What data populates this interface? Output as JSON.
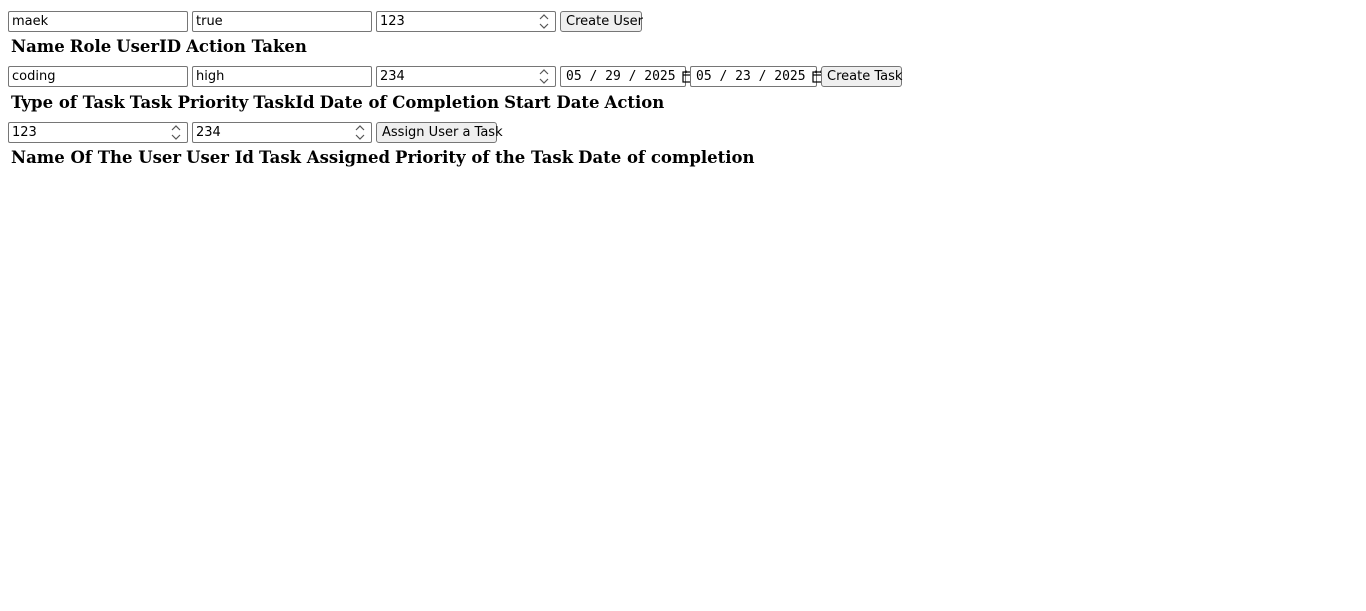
{
  "user_form": {
    "name_value": "maek",
    "role_value": "true",
    "userid_value": "123",
    "submit_label": "Create User"
  },
  "user_table": {
    "headers": [
      "Name",
      "Role",
      "UserID",
      "Action Taken"
    ]
  },
  "task_form": {
    "type_value": "coding",
    "priority_value": "high",
    "taskid_value": "234",
    "completion_date": {
      "month": "05",
      "day": "29",
      "year": "2025"
    },
    "start_date": {
      "month": "05",
      "day": "23",
      "year": "2025"
    },
    "submit_label": "Create Task"
  },
  "task_table": {
    "headers": [
      "Type of Task",
      "Task Priority",
      "TaskId",
      "Date of Completion",
      "Start Date",
      "Action"
    ]
  },
  "assign_form": {
    "userid_value": "123",
    "taskid_value": "234",
    "submit_label": "Assign User a Task"
  },
  "assignment_table": {
    "headers": [
      "Name Of The User",
      "User Id",
      "Task Assigned",
      "Priority of the Task",
      "Date of completion"
    ]
  },
  "icons": {
    "spinner": "spinner-arrows-icon",
    "calendar": "calendar-icon"
  }
}
